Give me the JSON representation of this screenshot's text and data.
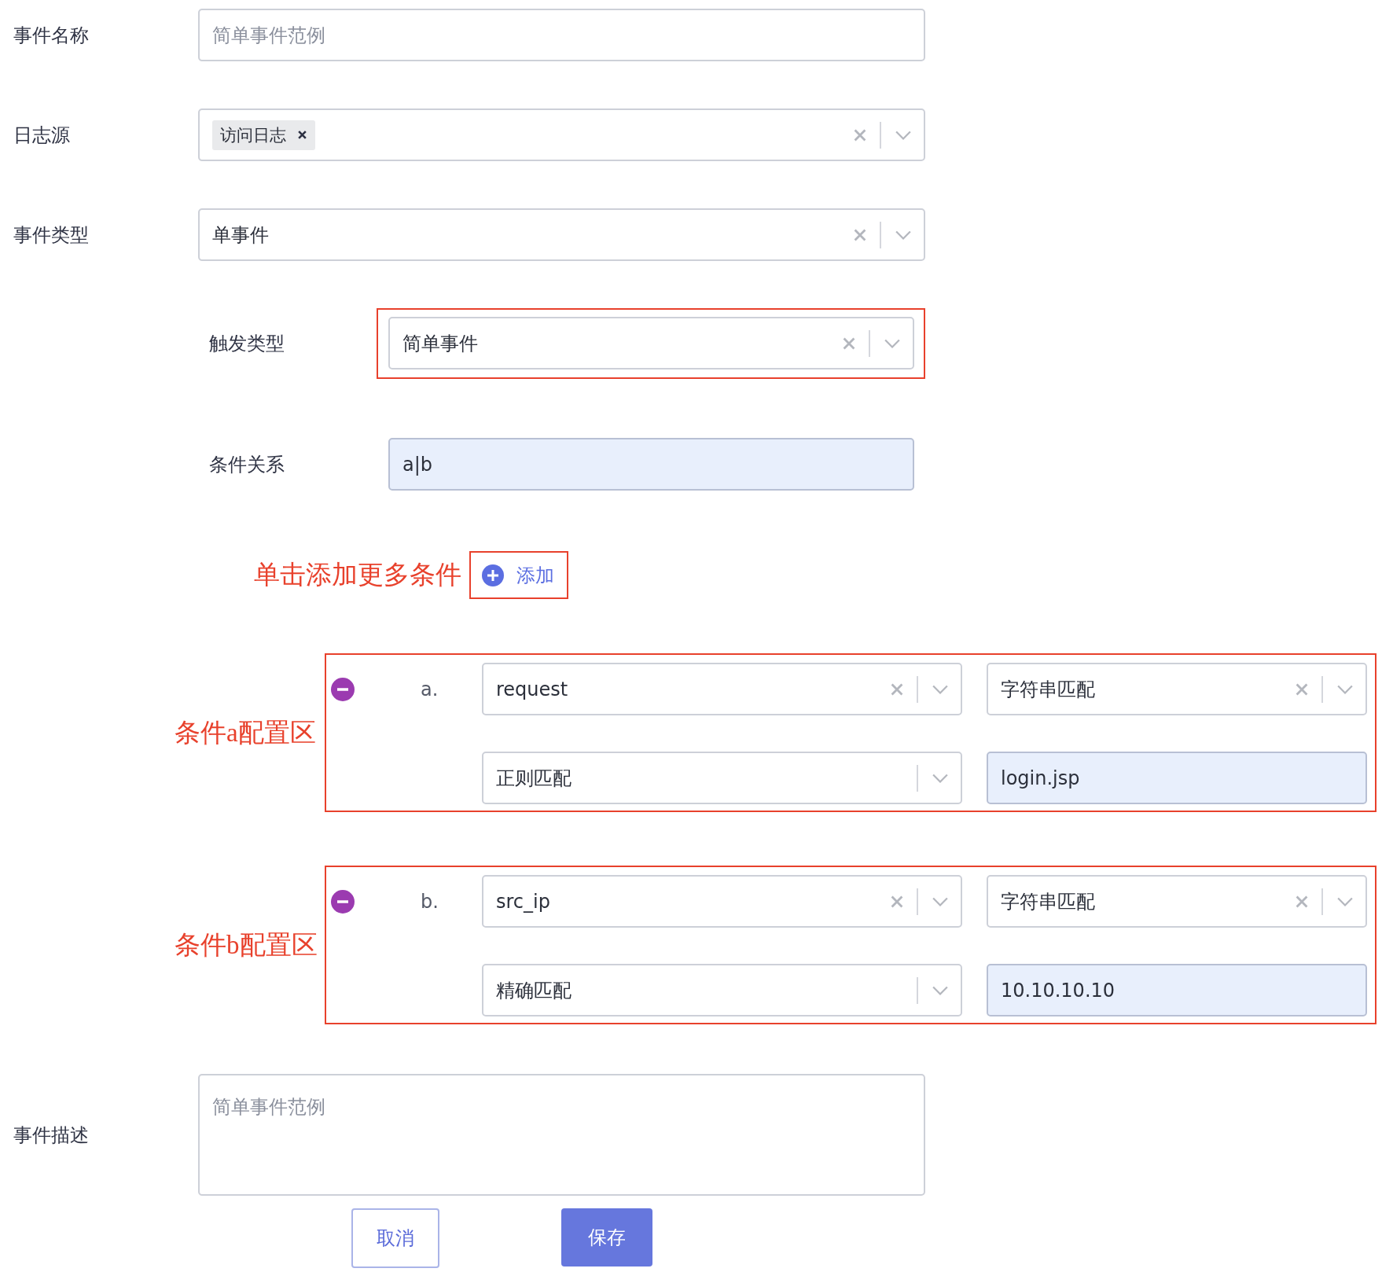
{
  "fields": [
    {
      "kind": "input",
      "label": "事件名称",
      "placeholder": "简单事件范例"
    },
    {
      "kind": "tags",
      "label": "日志源",
      "tags": [
        "访问日志"
      ]
    },
    {
      "kind": "select",
      "label": "事件类型",
      "value": "单事件"
    }
  ],
  "trigger": {
    "label": "触发类型",
    "value": "简单事件"
  },
  "relation": {
    "label": "条件关系",
    "value": "a|b"
  },
  "add": {
    "annotation": "单击添加更多条件",
    "label": "添加"
  },
  "conditions": [
    {
      "annotation": "条件a配置区",
      "letter": "a.",
      "field": "request",
      "match": "字符串匹配",
      "mode": "正则匹配",
      "value": "login.jsp"
    },
    {
      "annotation": "条件b配置区",
      "letter": "b.",
      "field": "src_ip",
      "match": "字符串匹配",
      "mode": "精确匹配",
      "value": "10.10.10.10"
    }
  ],
  "description": {
    "label": "事件描述",
    "placeholder": "简单事件范例"
  },
  "buttons": [
    {
      "kind": "secondary",
      "label": "取消"
    },
    {
      "kind": "primary",
      "label": "保存"
    }
  ]
}
